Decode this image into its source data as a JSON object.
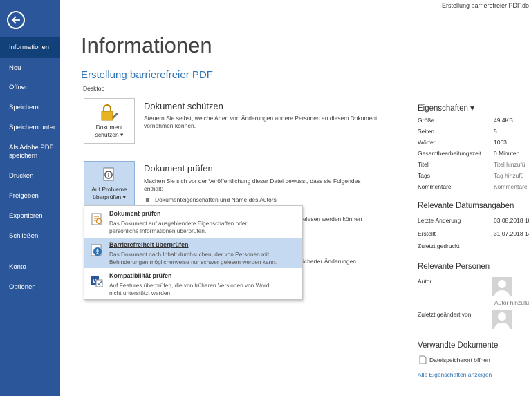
{
  "window": {
    "title": "Erstellung barrierefreier PDF.do"
  },
  "sidebar": {
    "items": [
      {
        "label": "Informationen"
      },
      {
        "label": "Neu"
      },
      {
        "label": "Öffnen"
      },
      {
        "label": "Speichern"
      },
      {
        "label": "Speichern unter"
      },
      {
        "label": "Als Adobe PDF speichern"
      },
      {
        "label": "Drucken"
      },
      {
        "label": "Freigeben"
      },
      {
        "label": "Exportieren"
      },
      {
        "label": "Schließen"
      },
      {
        "label": "Konto"
      },
      {
        "label": "Optionen"
      }
    ]
  },
  "main": {
    "page_title": "Informationen",
    "doc_title": "Erstellung barrierefreier PDF",
    "doc_location": "Desktop",
    "protect": {
      "tile_line1": "Dokument",
      "tile_line2": "schützen ▾",
      "heading": "Dokument schützen",
      "text1": "Steuern Sie selbst, welche Arten von Änderungen andere Personen an diesem Dokument",
      "text2": "vornehmen können."
    },
    "inspect": {
      "tile_line1": "Auf Probleme",
      "tile_line2": "überprüfen ▾",
      "heading": "Dokument prüfen",
      "text1": "Machen Sie sich vor der Veröffentlichung dieser Datei bewusst, dass sie Folgendes",
      "text2": "enthält:",
      "bullet1": "Dokumenteigenschaften und Name des Autors",
      "partial1": "elesen werden können",
      "partial2": "icherter Änderungen."
    },
    "dropdown": {
      "items": [
        {
          "title": "Dokument prüfen",
          "desc1": "Das Dokument auf ausgeblendete Eigenschaften oder",
          "desc2": "persönliche Informationen überprüfen."
        },
        {
          "title": "Barrierefreiheit überprüfen",
          "desc1": "Das Dokument nach Inhalt durchsuchen, der von Personen mit",
          "desc2": "Behinderungen möglicherweise nur schwer gelesen werden kann."
        },
        {
          "title": "Kompatibilität prüfen",
          "desc1": "Auf Features überprüfen, die von früheren Versionen von Word",
          "desc2": "nicht unterstützt werden."
        }
      ]
    }
  },
  "properties": {
    "heading": "Eigenschaften ▾",
    "rows": [
      {
        "label": "Größe",
        "value": "49,4KB"
      },
      {
        "label": "Seiten",
        "value": "5"
      },
      {
        "label": "Wörter",
        "value": "1063"
      },
      {
        "label": "Gesamtbearbeitungszeit",
        "value": "0 Minuten"
      },
      {
        "label": "Titel",
        "value": "Titel hinzufü"
      },
      {
        "label": "Tags",
        "value": "Tag hinzufü"
      },
      {
        "label": "Kommentare",
        "value": "Kommentare"
      }
    ],
    "dates_heading": "Relevante Datumsangaben",
    "dates": [
      {
        "label": "Letzte Änderung",
        "value": "03.08.2018 10"
      },
      {
        "label": "Erstellt",
        "value": "31.07.2018 14"
      },
      {
        "label": "Zuletzt gedruckt",
        "value": ""
      }
    ],
    "people_heading": "Relevante Personen",
    "author_label": "Autor",
    "author_add": "Autor hinzufü",
    "modified_by_label": "Zuletzt geändert von",
    "related_heading": "Verwandte Dokumente",
    "open_location": "Dateispeicherort öffnen",
    "all_props": "Alle Eigenschaften anzeigen"
  }
}
